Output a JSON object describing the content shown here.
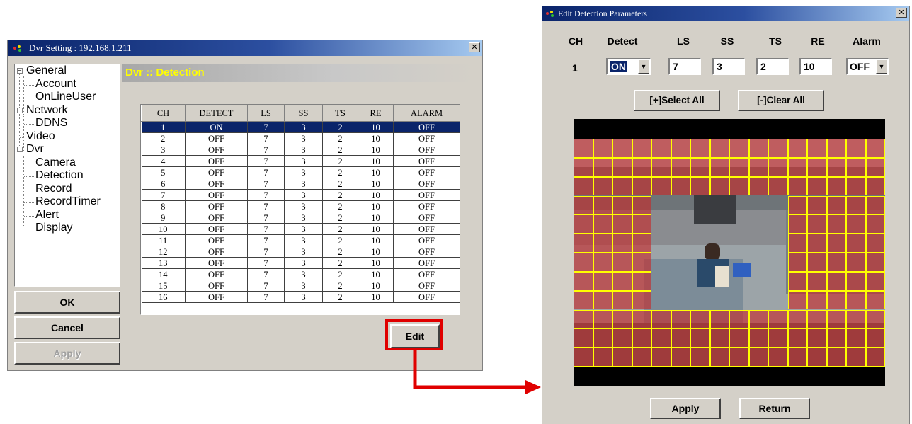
{
  "dvr_window": {
    "title": "Dvr Setting : 192.168.1.211",
    "close_symbol": "✕",
    "panel_title": "Dvr :: Detection",
    "tree": [
      {
        "label": "General",
        "level": 0,
        "expanded": true
      },
      {
        "label": "Account",
        "level": 1
      },
      {
        "label": "OnLineUser",
        "level": 1
      },
      {
        "label": "Network",
        "level": 0,
        "expanded": true
      },
      {
        "label": "DDNS",
        "level": 1
      },
      {
        "label": "Video",
        "level": 0
      },
      {
        "label": "Dvr",
        "level": 0,
        "expanded": true
      },
      {
        "label": "Camera",
        "level": 1
      },
      {
        "label": "Detection",
        "level": 1
      },
      {
        "label": "Record",
        "level": 1
      },
      {
        "label": "RecordTimer",
        "level": 1
      },
      {
        "label": "Alert",
        "level": 1
      },
      {
        "label": "Display",
        "level": 1
      }
    ],
    "buttons": {
      "ok": "OK",
      "cancel": "Cancel",
      "apply": "Apply",
      "edit": "Edit"
    },
    "table": {
      "columns": [
        "CH",
        "DETECT",
        "LS",
        "SS",
        "TS",
        "RE",
        "ALARM"
      ],
      "selected_row": 0,
      "rows": [
        [
          "1",
          "ON",
          "7",
          "3",
          "2",
          "10",
          "OFF"
        ],
        [
          "2",
          "OFF",
          "7",
          "3",
          "2",
          "10",
          "OFF"
        ],
        [
          "3",
          "OFF",
          "7",
          "3",
          "2",
          "10",
          "OFF"
        ],
        [
          "4",
          "OFF",
          "7",
          "3",
          "2",
          "10",
          "OFF"
        ],
        [
          "5",
          "OFF",
          "7",
          "3",
          "2",
          "10",
          "OFF"
        ],
        [
          "6",
          "OFF",
          "7",
          "3",
          "2",
          "10",
          "OFF"
        ],
        [
          "7",
          "OFF",
          "7",
          "3",
          "2",
          "10",
          "OFF"
        ],
        [
          "8",
          "OFF",
          "7",
          "3",
          "2",
          "10",
          "OFF"
        ],
        [
          "9",
          "OFF",
          "7",
          "3",
          "2",
          "10",
          "OFF"
        ],
        [
          "10",
          "OFF",
          "7",
          "3",
          "2",
          "10",
          "OFF"
        ],
        [
          "11",
          "OFF",
          "7",
          "3",
          "2",
          "10",
          "OFF"
        ],
        [
          "12",
          "OFF",
          "7",
          "3",
          "2",
          "10",
          "OFF"
        ],
        [
          "13",
          "OFF",
          "7",
          "3",
          "2",
          "10",
          "OFF"
        ],
        [
          "14",
          "OFF",
          "7",
          "3",
          "2",
          "10",
          "OFF"
        ],
        [
          "15",
          "OFF",
          "7",
          "3",
          "2",
          "10",
          "OFF"
        ],
        [
          "16",
          "OFF",
          "7",
          "3",
          "2",
          "10",
          "OFF"
        ]
      ]
    }
  },
  "edit_window": {
    "title": "Edit Detection Parameters",
    "close_symbol": "✕",
    "headers": {
      "ch": "CH",
      "detect": "Detect",
      "ls": "LS",
      "ss": "SS",
      "ts": "TS",
      "re": "RE",
      "alarm": "Alarm"
    },
    "values": {
      "ch": "1",
      "detect": "ON",
      "ls": "7",
      "ss": "3",
      "ts": "2",
      "re": "10",
      "alarm": "OFF"
    },
    "select_all": "[+]Select All",
    "clear_all": "[-]Clear All",
    "apply": "Apply",
    "return": "Return",
    "motion_grid": {
      "cols": 16,
      "rows": 12,
      "unselected_rect": {
        "col_start": 4,
        "col_end": 10,
        "row_start": 3,
        "row_end": 8
      },
      "unselected_extra": [
        [
          4,
          9
        ],
        [
          4,
          10
        ],
        [
          5,
          9
        ],
        [
          5,
          10
        ],
        [
          6,
          9
        ],
        [
          6,
          10
        ],
        [
          7,
          9
        ],
        [
          7,
          10
        ],
        [
          8,
          9
        ],
        [
          8,
          10
        ]
      ],
      "selected_color": "#c03030",
      "grid_line_color": "#ffff00"
    }
  },
  "colors": {
    "highlight_box": "#e00000",
    "arrow": "#e00000",
    "selection": "#0a246a",
    "panel_title_text": "#ffff00"
  },
  "icons": {
    "app_icon": "app-icon",
    "dropdown": "dropdown-arrow-icon"
  }
}
